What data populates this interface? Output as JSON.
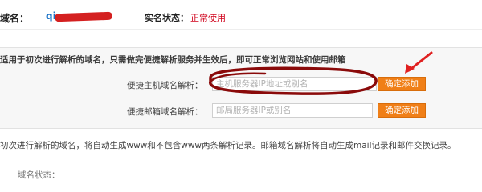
{
  "domain": {
    "label": "域名：",
    "value": "qi       .com"
  },
  "status": {
    "label": "实名状态：",
    "value": "正常使用"
  },
  "panel": {
    "notice": "适用于初次进行解析的域名，只需做完便捷解析服务并生效后，即可正常浏览网站和使用邮箱",
    "host_field": {
      "label": "便捷主机域名解析：",
      "placeholder": "主机服务器IP地址或别名",
      "button": "确定添加"
    },
    "mail_field": {
      "label": "便捷邮箱域名解析：",
      "placeholder": "邮局服务器IP或别名",
      "button": "确定添加"
    }
  },
  "hint": "初次进行解析的域名，将自动生成www和不包含www两条解析记录。邮箱域名解析将自动生成mail记录和邮件交换记录。",
  "cutoff_text": "域名状态：",
  "colors": {
    "accent_orange": "#f07f17",
    "status_red": "#d0021b",
    "link_blue": "#1a73c8",
    "annotation_red": "#8a0a0a"
  }
}
